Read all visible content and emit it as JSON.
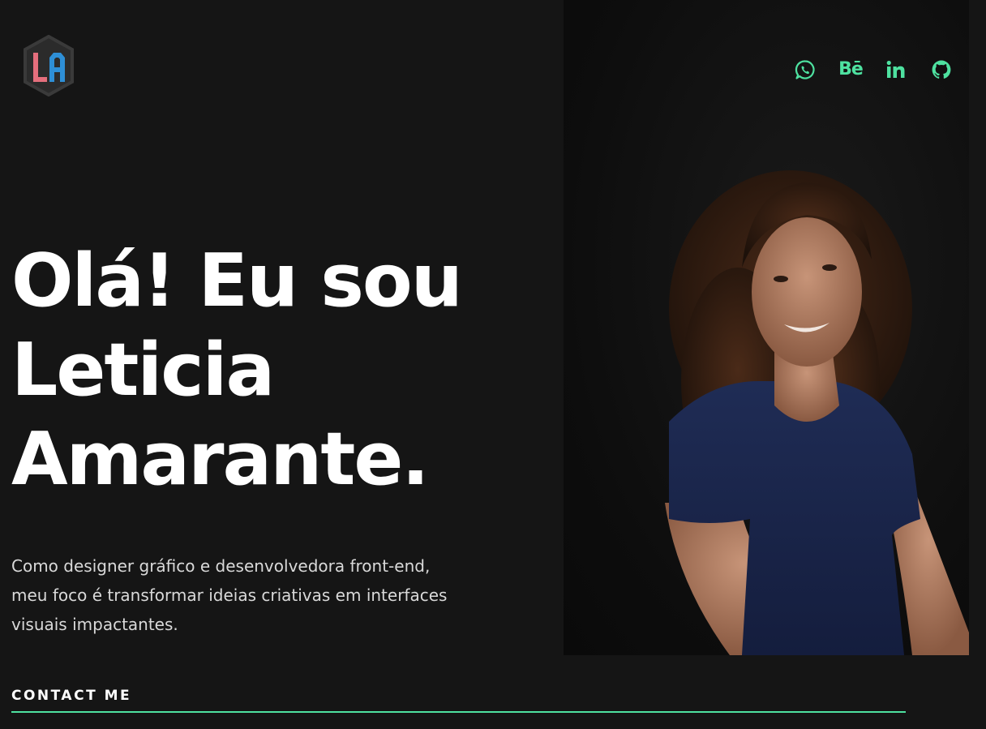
{
  "brand": {
    "logo_letters": "LA",
    "logo_colors": {
      "left": "#e56f7d",
      "right": "#2e8fd6",
      "frame": "#3a3a3a"
    }
  },
  "theme": {
    "background": "#151515",
    "accent": "#4ee1a0",
    "text": "#ffffff",
    "muted_text": "#d9d9d9"
  },
  "social": [
    {
      "name": "WhatsApp",
      "icon": "whatsapp-icon"
    },
    {
      "name": "Behance",
      "icon": "behance-icon",
      "glyph": "Bē"
    },
    {
      "name": "LinkedIn",
      "icon": "linkedin-icon",
      "glyph": "in"
    },
    {
      "name": "GitHub",
      "icon": "github-icon"
    }
  ],
  "hero": {
    "title_line1": "Olá! Eu sou",
    "title_line2": "Leticia",
    "title_line3": "Amarante.",
    "description": "Como designer gráfico e desenvolvedora front-end, meu foco é transformar ideias criativas em interfaces visuais impactantes.",
    "cta_label": "CONTACT ME"
  }
}
